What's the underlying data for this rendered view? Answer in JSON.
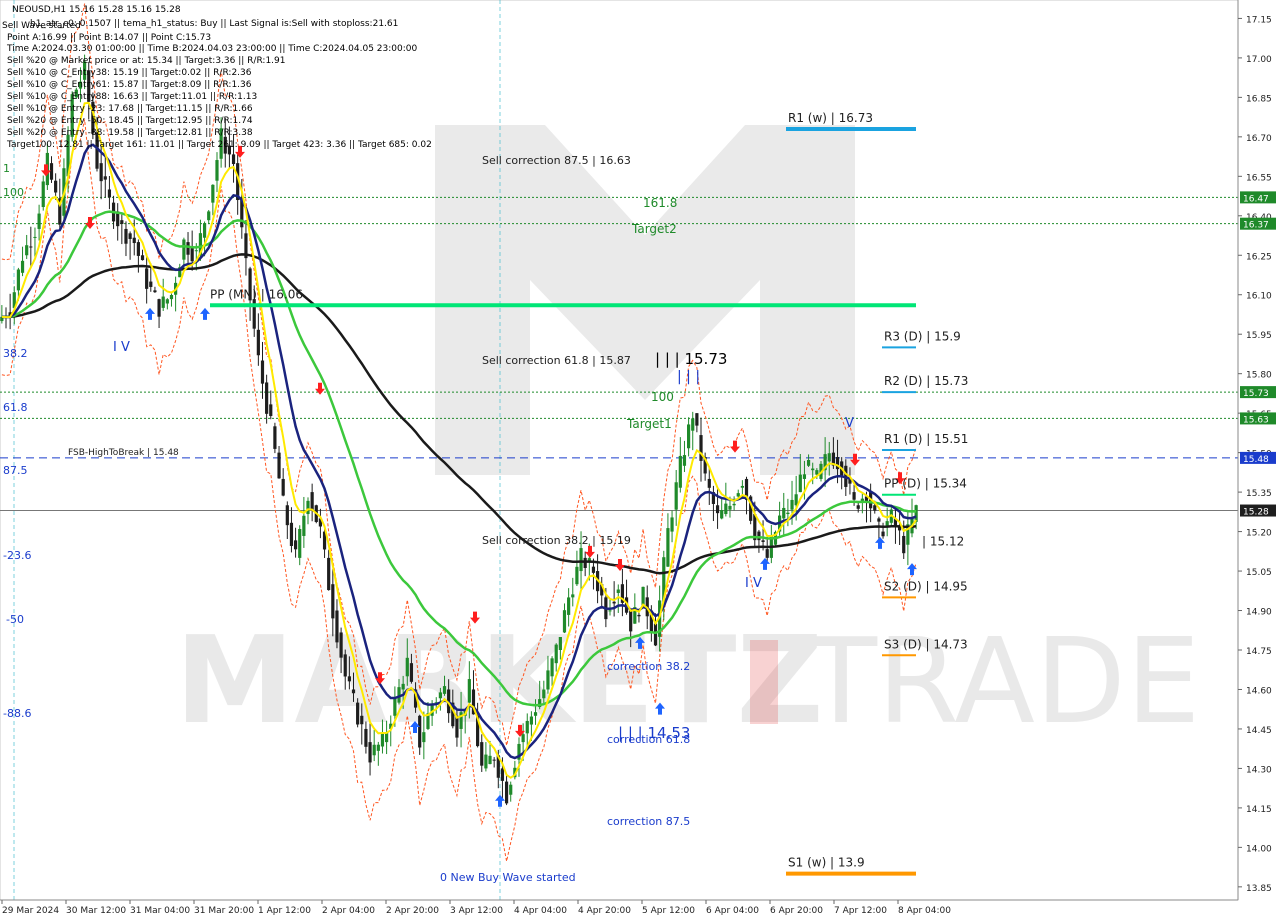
{
  "header": {
    "lines": [
      "NEOUSD,H1  15.16 15.28 15.16 15.28",
      "h1_atr_c0: 0.1507  ||  tema_h1_status: Buy  ||  Last Signal is:Sell with stoploss:21.61",
      "Point A:16.99 || Point B:14.07 || Point C:15.73",
      "Time A:2024.03.30 01:00:00 || Time B:2024.04.03 23:00:00 || Time C:2024.04.05 23:00:00",
      "Sell %20 @ Market price or at: 15.34 || Target:3.36 || R/R:1.91",
      "Sell %10 @ C_Entry38: 15.19 || Target:0.02 || R/R:2.36",
      "Sell %10 @ C_Entry61: 15.87 || Target:8.09 || R/R:1.36",
      "Sell %10 @ C_Entry88: 16.63 || Target:11.01 || R/R:1.13",
      "Sell %10 @ Entry -23: 17.68 || Target:11.15 || R/R:1.66",
      "Sell %20 @ Entry -50: 18.45 || Target:12.95 || R/R:1.74",
      "Sell %20 @ Entry -88: 19.58 || Target:12.81 || R/R:3.38",
      "Target100: 12.81 || Target 161: 11.01 || Target 261: 9.09 || Target 423: 3.36 || Target 685: 0.02"
    ],
    "overlay_text": "Sell Wave started"
  },
  "price_axis": {
    "ticks": [
      "17.15",
      "17.00",
      "16.85",
      "16.70",
      "16.55",
      "16.40",
      "16.25",
      "16.10",
      "15.95",
      "15.80",
      "15.65",
      "15.50",
      "15.35",
      "15.20",
      "15.05",
      "14.90",
      "14.75",
      "14.60",
      "14.45",
      "14.30",
      "14.15",
      "14.00",
      "13.85"
    ],
    "badges": [
      {
        "label": "16.47",
        "value": 16.47,
        "color": "#1f8a2a"
      },
      {
        "label": "16.37",
        "value": 16.37,
        "color": "#1f8a2a"
      },
      {
        "label": "15.73",
        "value": 15.73,
        "color": "#1f8a2a"
      },
      {
        "label": "15.63",
        "value": 15.63,
        "color": "#1f8a2a"
      },
      {
        "label": "15.48",
        "value": 15.48,
        "color": "#1a3ccc"
      },
      {
        "label": "15.28",
        "value": 15.28,
        "color": "#1e1e1e"
      }
    ]
  },
  "time_axis": {
    "labels": [
      "29 Mar 2024",
      "30 Mar 12:00",
      "31 Mar 04:00",
      "31 Mar 20:00",
      "1 Apr 12:00",
      "2 Apr 04:00",
      "2 Apr 20:00",
      "3 Apr 12:00",
      "4 Apr 04:00",
      "4 Apr 20:00",
      "5 Apr 12:00",
      "6 Apr 04:00",
      "6 Apr 20:00",
      "7 Apr 12:00",
      "8 Apr 04:00"
    ]
  },
  "levels": [
    {
      "label": "R1 (w) | 16.73",
      "value": 16.73,
      "color": "#1aa3e0"
    },
    {
      "label": "PP (MN) | 16.06",
      "value": 16.06,
      "color": "#00e676"
    },
    {
      "label": "R3 (D) | 15.9",
      "value": 15.9,
      "color": "#1aa3e0"
    },
    {
      "label": "R2 (D) | 15.73",
      "value": 15.73,
      "color": "#1aa3e0"
    },
    {
      "label": "R1 (D) | 15.51",
      "value": 15.51,
      "color": "#1aa3e0"
    },
    {
      "label": "PP (D) | 15.34",
      "value": 15.34,
      "color": "#00e676"
    },
    {
      "label": "| 15.12",
      "value": 15.12,
      "color": "#000000"
    },
    {
      "label": "S2 (D) | 14.95",
      "value": 14.95,
      "color": "#ff9800"
    },
    {
      "label": "S3 (D) | 14.73",
      "value": 14.73,
      "color": "#ff9800"
    },
    {
      "label": "S1 (w) | 13.9",
      "value": 13.9,
      "color": "#ff9800"
    }
  ],
  "hlines": [
    {
      "label": "FSB-HighToBreak | 15.48",
      "value": 15.48,
      "color": "#1a3ccc"
    },
    {
      "label": "",
      "value": 16.47,
      "color": "#1f8a2a"
    },
    {
      "label": "",
      "value": 16.37,
      "color": "#1f8a2a"
    },
    {
      "label": "",
      "value": 15.73,
      "color": "#1f8a2a"
    },
    {
      "label": "",
      "value": 15.63,
      "color": "#1f8a2a"
    }
  ],
  "annotations": [
    {
      "text": "Sell correction 87.5 | 16.63",
      "color": "#1e1e1e"
    },
    {
      "text": "161.8",
      "color": "#1f8a2a"
    },
    {
      "text": "Target2",
      "color": "#1f8a2a"
    },
    {
      "text": "Sell correction 61.8 | 15.87",
      "color": "#1e1e1e"
    },
    {
      "text": "| | | 15.73",
      "color": "#000000"
    },
    {
      "text": "| | |",
      "color": "#1a3ccc"
    },
    {
      "text": "100",
      "color": "#1f8a2a"
    },
    {
      "text": "Target1",
      "color": "#1f8a2a"
    },
    {
      "text": "Sell correction 38.2 | 15.19",
      "color": "#1e1e1e"
    },
    {
      "text": "correction 38.2",
      "color": "#1a3ccc"
    },
    {
      "text": "| | | 14.53",
      "color": "#1a3ccc"
    },
    {
      "text": "correction 61.8",
      "color": "#1a3ccc"
    },
    {
      "text": "correction 87.5",
      "color": "#1a3ccc"
    },
    {
      "text": "0 New Buy Wave started",
      "color": "#1a3ccc"
    },
    {
      "text": "I V",
      "color": "#1a3ccc"
    },
    {
      "text": "I V",
      "color": "#1a3ccc"
    },
    {
      "text": "V",
      "color": "#1a3ccc"
    }
  ],
  "left_labels": [
    {
      "text": "38.2",
      "color": "#1a3ccc"
    },
    {
      "text": "61.8",
      "color": "#1a3ccc"
    },
    {
      "text": "87.5",
      "color": "#1a3ccc"
    },
    {
      "text": "-23.6",
      "color": "#1a3ccc"
    },
    {
      "text": "-50",
      "color": "#1a3ccc"
    },
    {
      "text": "-88.6",
      "color": "#1a3ccc"
    },
    {
      "text": "100",
      "color": "#1f8a2a"
    },
    {
      "text": "1",
      "color": "#1f8a2a"
    }
  ],
  "watermark": {
    "left": "MARKETZ",
    "right": "TRADE"
  },
  "colors": {
    "bull": "#1f8a2a",
    "bear": "#1e1e1e",
    "ema_fast": "#ffea00",
    "ema_blue": "#1a237e",
    "ema_green": "#3cc83c",
    "ema_black": "#1a1a1a",
    "channel": "#ff5722",
    "buy_arrow": "#1e64ff",
    "sell_arrow": "#ff1e1e"
  },
  "chart_data": {
    "type": "candlestick",
    "symbol": "NEOUSD",
    "timeframe": "H1",
    "ylim": [
      13.8,
      17.22
    ],
    "last_price": 15.28,
    "ohlc_last": {
      "open": 15.16,
      "high": 15.28,
      "low": 15.16,
      "close": 15.28
    },
    "series": [
      {
        "name": "close",
        "values": [
          16.05,
          16.25,
          16.35,
          16.6,
          16.4,
          16.85,
          16.95,
          16.6,
          16.45,
          16.35,
          16.3,
          16.15,
          16.05,
          16.1,
          16.3,
          16.25,
          16.45,
          16.7,
          16.6,
          16.2,
          15.85,
          15.6,
          15.3,
          15.1,
          15.35,
          15.2,
          14.9,
          14.65,
          14.5,
          14.35,
          14.4,
          14.55,
          14.7,
          14.4,
          14.55,
          14.6,
          14.45,
          14.6,
          14.3,
          14.35,
          14.2,
          14.4,
          14.5,
          14.6,
          14.75,
          14.95,
          15.1,
          15.05,
          14.9,
          15.0,
          14.85,
          14.95,
          14.8,
          15.2,
          15.45,
          15.65,
          15.4,
          15.25,
          15.3,
          15.4,
          15.2,
          15.1,
          15.25,
          15.3,
          15.45,
          15.4,
          15.5,
          15.45,
          15.3,
          15.35,
          15.2,
          15.25,
          15.15,
          15.28
        ]
      }
    ]
  }
}
